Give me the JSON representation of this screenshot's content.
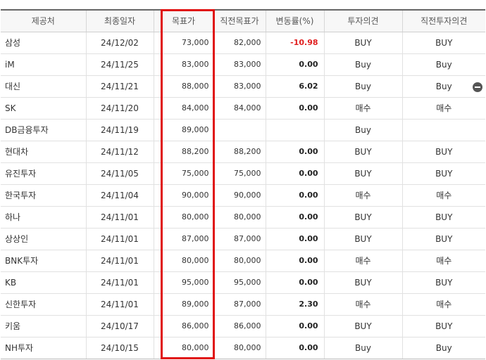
{
  "headers": [
    "제공처",
    "최종일자",
    "목표가",
    "직전목표가",
    "변동률(%)",
    "투자의견",
    "직전투자의견"
  ],
  "rows": [
    {
      "firm": "삼성",
      "date": "24/12/02",
      "target": "73,000",
      "prev_target": "82,000",
      "change": "-10.98",
      "opinion": "BUY",
      "prev_opinion": "BUY"
    },
    {
      "firm": "iM",
      "date": "24/11/25",
      "target": "83,000",
      "prev_target": "83,000",
      "change": "0.00",
      "opinion": "Buy",
      "prev_opinion": "Buy"
    },
    {
      "firm": "대신",
      "date": "24/11/21",
      "target": "88,000",
      "prev_target": "83,000",
      "change": "6.02",
      "opinion": "Buy",
      "prev_opinion": "Buy"
    },
    {
      "firm": "SK",
      "date": "24/11/20",
      "target": "84,000",
      "prev_target": "84,000",
      "change": "0.00",
      "opinion": "매수",
      "prev_opinion": "매수"
    },
    {
      "firm": "DB금융투자",
      "date": "24/11/19",
      "target": "89,000",
      "prev_target": "",
      "change": "",
      "opinion": "Buy",
      "prev_opinion": ""
    },
    {
      "firm": "현대차",
      "date": "24/11/12",
      "target": "88,200",
      "prev_target": "88,200",
      "change": "0.00",
      "opinion": "BUY",
      "prev_opinion": "BUY"
    },
    {
      "firm": "유진투자",
      "date": "24/11/05",
      "target": "75,000",
      "prev_target": "75,000",
      "change": "0.00",
      "opinion": "BUY",
      "prev_opinion": "BUY"
    },
    {
      "firm": "한국투자",
      "date": "24/11/04",
      "target": "90,000",
      "prev_target": "90,000",
      "change": "0.00",
      "opinion": "매수",
      "prev_opinion": "매수"
    },
    {
      "firm": "하나",
      "date": "24/11/01",
      "target": "80,000",
      "prev_target": "80,000",
      "change": "0.00",
      "opinion": "BUY",
      "prev_opinion": "BUY"
    },
    {
      "firm": "상상인",
      "date": "24/11/01",
      "target": "87,000",
      "prev_target": "87,000",
      "change": "0.00",
      "opinion": "BUY",
      "prev_opinion": "BUY"
    },
    {
      "firm": "BNK투자",
      "date": "24/11/01",
      "target": "80,000",
      "prev_target": "80,000",
      "change": "0.00",
      "opinion": "매수",
      "prev_opinion": "매수"
    },
    {
      "firm": "KB",
      "date": "24/11/01",
      "target": "95,000",
      "prev_target": "95,000",
      "change": "0.00",
      "opinion": "BUY",
      "prev_opinion": "BUY"
    },
    {
      "firm": "신한투자",
      "date": "24/11/01",
      "target": "89,000",
      "prev_target": "87,000",
      "change": "2.30",
      "opinion": "매수",
      "prev_opinion": "매수"
    },
    {
      "firm": "키움",
      "date": "24/10/17",
      "target": "86,000",
      "prev_target": "86,000",
      "change": "0.00",
      "opinion": "BUY",
      "prev_opinion": "BUY"
    },
    {
      "firm": "NH투자",
      "date": "24/10/15",
      "target": "80,000",
      "prev_target": "80,000",
      "change": "0.00",
      "opinion": "Buy",
      "prev_opinion": "Buy"
    }
  ],
  "colors": {
    "highlight": "#e01010",
    "negative": "#e02020"
  },
  "icons": {
    "row_action": "minus-circle-icon"
  }
}
